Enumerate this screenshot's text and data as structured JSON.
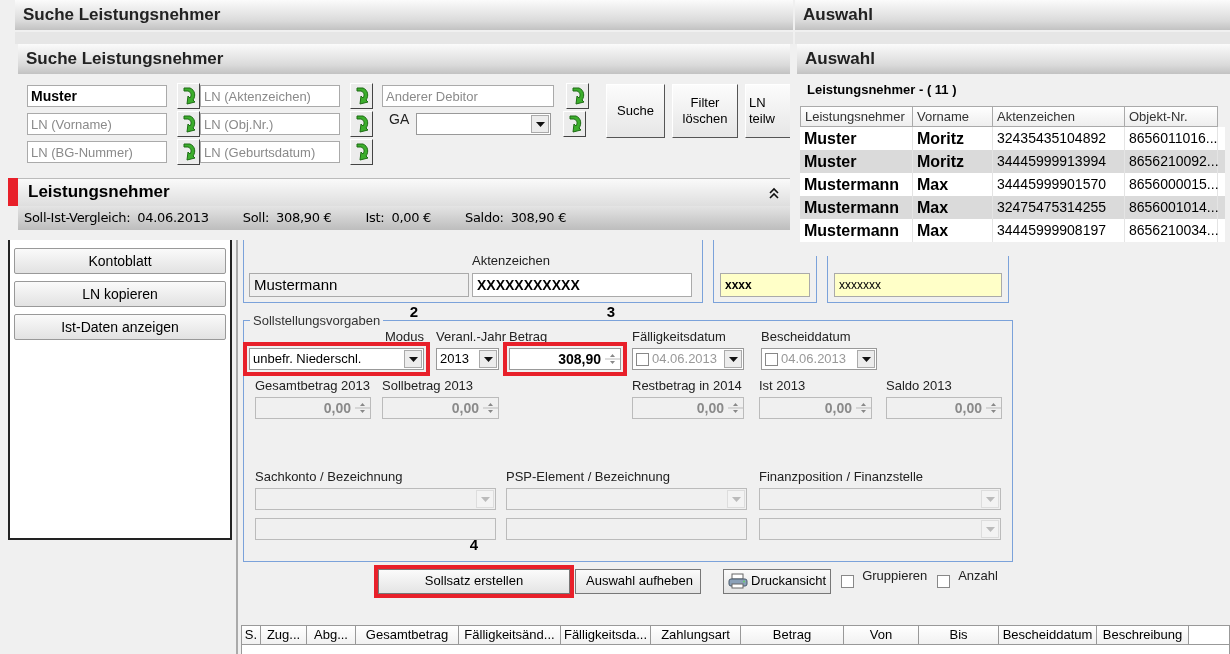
{
  "back_window": {
    "search_title": "Suche Leistungsnehmer",
    "selection_title": "Auswahl"
  },
  "search_panel": {
    "title": "Suche Leistungsnehmer",
    "fields": [
      {
        "kind": "text",
        "value": "Muster"
      },
      {
        "kind": "text",
        "placeholder": "LN (Aktenzeichen)"
      },
      {
        "kind": "text",
        "placeholder": "Anderer Debitor"
      },
      {
        "kind": "text",
        "placeholder": "LN (Vorname)"
      },
      {
        "kind": "text",
        "placeholder": "LN (Obj.Nr.)"
      },
      {
        "kind": "combo",
        "label": "GA"
      },
      {
        "kind": "text",
        "placeholder": "LN (BG-Nummer)"
      },
      {
        "kind": "text",
        "placeholder": "LN (Geburtsdatum)"
      }
    ],
    "buttons": [
      "Suche",
      "Filter löschen",
      "LN teilw"
    ],
    "section_title": "Leistungsnehmer",
    "status_bar": [
      {
        "label": "Soll-Ist-Vergleich:",
        "value": "04.06.2013"
      },
      {
        "label": "Soll:",
        "value": "308,90 €"
      },
      {
        "label": "Ist:",
        "value": "0,00 €"
      },
      {
        "label": "Saldo:",
        "value": "308,90 €"
      }
    ]
  },
  "selection_panel": {
    "title": "Auswahl",
    "subtitle": "Leistungsnehmer - ( 11 )",
    "columns": [
      "Leistungsnehmer",
      "Vorname",
      "Aktenzeichen",
      "Objekt-Nr."
    ],
    "rows": [
      {
        "cells": [
          "Muster",
          "Moritz",
          "32435435104892",
          "8656011016..."
        ],
        "selected": false
      },
      {
        "cells": [
          "Muster",
          "Moritz",
          "34445999913994",
          "8656210092..."
        ],
        "selected": true
      },
      {
        "cells": [
          "Mustermann",
          "Max",
          "34445999901570",
          "8656000015..."
        ],
        "selected": false
      },
      {
        "cells": [
          "Mustermann",
          "Max",
          "32475475314255",
          "8656001014..."
        ],
        "selected": true
      },
      {
        "cells": [
          "Mustermann",
          "Max",
          "34445999908197",
          "8656210034..."
        ],
        "selected": false
      }
    ]
  },
  "sidebar": {
    "buttons": [
      "Kontoblatt",
      "LN kopieren",
      "Ist-Daten anzeigen"
    ]
  },
  "recipient": {
    "name": "Mustermann",
    "file_label": "Aktenzeichen",
    "file_number": "XXXXXXXXXXX",
    "field_3": "xxxx",
    "field_4": "xxxxxxx"
  },
  "targets": {
    "title": "Sollstellungsvorgaben",
    "row_1": [
      {
        "kind": "combo",
        "label": "Modus",
        "value": "unbefr. Niederschl.",
        "highlighted": true,
        "annotation": "2"
      },
      {
        "kind": "combo",
        "label": "Veranl.-Jahr",
        "value": "2013"
      },
      {
        "kind": "spinner",
        "label": "Betrag",
        "value": "308,90",
        "highlighted": true,
        "annotation": "3"
      },
      {
        "kind": "date",
        "label": "Fälligkeitsdatum",
        "value": "04.06.2013",
        "checked": false
      },
      {
        "kind": "date",
        "label": "Bescheiddatum",
        "value": "04.06.2013",
        "checked": false
      }
    ],
    "row_2": [
      {
        "kind": "spinner",
        "label": "Gesamtbetrag 2013",
        "value": "0,00",
        "disabled": true
      },
      {
        "kind": "spinner",
        "label": "Sollbetrag 2013",
        "value": "0,00",
        "disabled": true
      },
      {
        "kind": "spinner",
        "label": "Restbetrag in 2014",
        "value": "0,00",
        "disabled": true
      },
      {
        "kind": "spinner",
        "label": "Ist 2013",
        "value": "0,00",
        "disabled": true
      },
      {
        "kind": "spinner",
        "label": "Saldo 2013",
        "value": "0,00",
        "disabled": true
      }
    ],
    "row_3": [
      {
        "kind": "combo",
        "label": "Sachkonto / Bezeichnung",
        "disabled": true
      },
      {
        "kind": "combo",
        "label": "PSP-Element / Bezeichnung",
        "disabled": true
      },
      {
        "kind": "combo",
        "label": "Finanzposition / Finanzstelle",
        "disabled": true
      }
    ],
    "row_4": [
      {
        "kind": "text",
        "disabled": true
      },
      {
        "kind": "text",
        "disabled": true
      },
      {
        "kind": "combo",
        "disabled": true
      }
    ]
  },
  "actions": [
    {
      "kind": "button",
      "label": "Sollsatz erstellen",
      "highlighted": true,
      "annotation": "4"
    },
    {
      "kind": "button",
      "label": "Auswahl aufheben"
    },
    {
      "kind": "print",
      "label": "Druckansicht"
    },
    {
      "kind": "checkbox",
      "label": "Gruppieren",
      "checked": false
    },
    {
      "kind": "checkbox",
      "label": "Anzahl",
      "checked": false
    }
  ],
  "entries_table": {
    "columns": [
      "S.",
      "Zug...",
      "Abg...",
      "Gesamtbetrag",
      "Fälligkeitsänd...",
      "Fälligkeitsda...",
      "Zahlungsart",
      "Betrag",
      "Von",
      "Bis",
      "Bescheiddatum",
      "Beschreibung"
    ]
  }
}
